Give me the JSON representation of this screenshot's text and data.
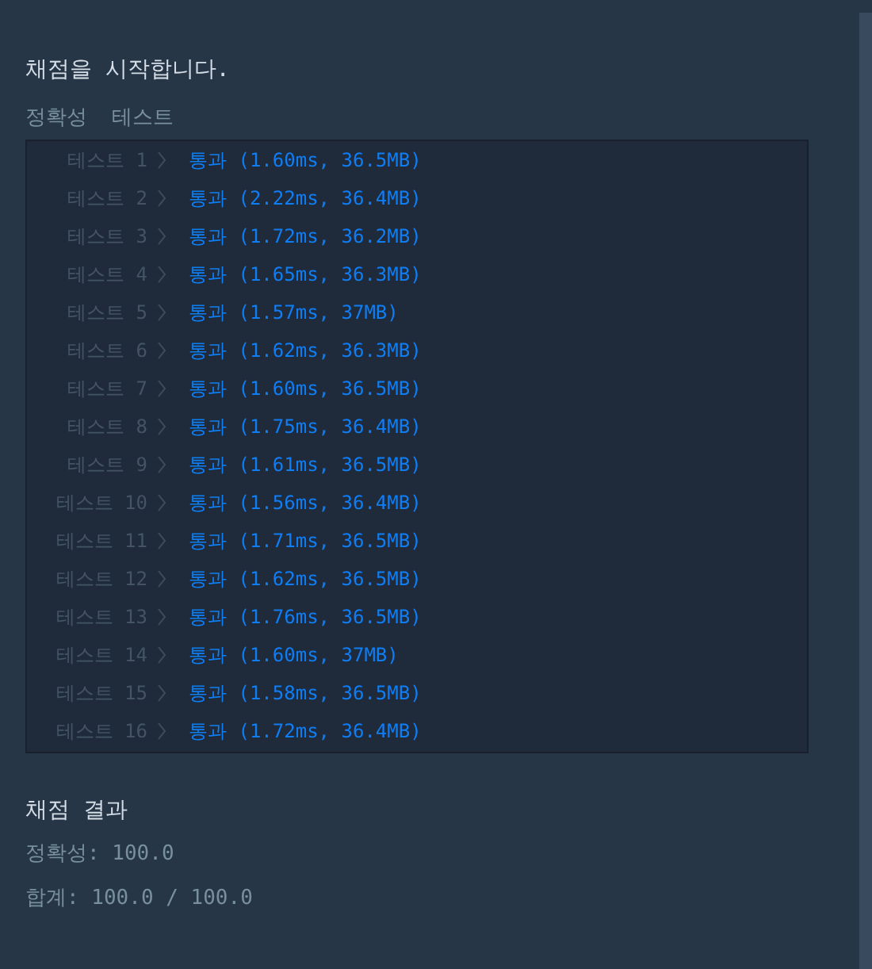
{
  "heading": "채점을 시작합니다.",
  "section_label": "정확성  테스트",
  "tests": [
    {
      "label": "테스트 1",
      "kind": "pass",
      "result": "통과 (1.60ms, 36.5MB)"
    },
    {
      "label": "테스트 2",
      "kind": "pass",
      "result": "통과 (2.22ms, 36.4MB)"
    },
    {
      "label": "테스트 3",
      "kind": "pass",
      "result": "통과 (1.72ms, 36.2MB)"
    },
    {
      "label": "테스트 4",
      "kind": "pass",
      "result": "통과 (1.65ms, 36.3MB)"
    },
    {
      "label": "테스트 5",
      "kind": "pass",
      "result": "통과 (1.57ms, 37MB)"
    },
    {
      "label": "테스트 6",
      "kind": "pass",
      "result": "통과 (1.62ms, 36.3MB)"
    },
    {
      "label": "테스트 7",
      "kind": "pass",
      "result": "통과 (1.60ms, 36.5MB)"
    },
    {
      "label": "테스트 8",
      "kind": "pass",
      "result": "통과 (1.75ms, 36.4MB)"
    },
    {
      "label": "테스트 9",
      "kind": "pass",
      "result": "통과 (1.61ms, 36.5MB)"
    },
    {
      "label": "테스트 10",
      "kind": "pass",
      "result": "통과 (1.56ms, 36.4MB)"
    },
    {
      "label": "테스트 11",
      "kind": "pass",
      "result": "통과 (1.71ms, 36.5MB)"
    },
    {
      "label": "테스트 12",
      "kind": "pass",
      "result": "통과 (1.62ms, 36.5MB)"
    },
    {
      "label": "테스트 13",
      "kind": "pass",
      "result": "통과 (1.76ms, 36.5MB)"
    },
    {
      "label": "테스트 14",
      "kind": "pass",
      "result": "통과 (1.60ms, 37MB)"
    },
    {
      "label": "테스트 15",
      "kind": "pass",
      "result": "통과 (1.58ms, 36.5MB)"
    },
    {
      "label": "테스트 16",
      "kind": "pass",
      "result": "통과 (1.72ms, 36.4MB)"
    }
  ],
  "summary": {
    "title": "채점 결과",
    "lines": [
      "정확성: 100.0",
      "합계: 100.0 / 100.0"
    ]
  }
}
